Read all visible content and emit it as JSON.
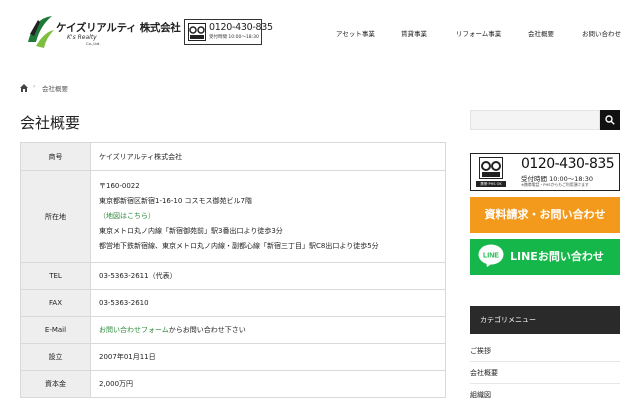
{
  "header": {
    "logo_name": "ケイズリアルティ 株式会社",
    "logo_sub": "K's Realty",
    "logo_sub2": "Co.,Ltd.",
    "tel_number": "0120-430-835",
    "tel_hours": "受付時間 10:00〜18:30",
    "nav": [
      "アセット事業",
      "賃貸事業",
      "リフォーム事業",
      "会社概要",
      "お問い合わせ"
    ]
  },
  "breadcrumb": {
    "home_icon": "home-icon",
    "current": "会社概要"
  },
  "page_title": "会社概要",
  "company_table": [
    {
      "label": "商号",
      "lines": [
        "ケイズリアルティ株式会社"
      ]
    },
    {
      "label": "所在地",
      "lines": [
        "〒160-0022",
        "東京都新宿区新宿1-16-10 コスモス御苑ビル7階",
        "（地図はこちら）",
        "東京メトロ丸ノ内線「新宿御苑前」駅3番出口より徒歩3分",
        "都営地下鉄新宿線、東京メトロ丸ノ内線・副都心線「新宿三丁目」駅C8出口より徒歩5分"
      ]
    },
    {
      "label": "TEL",
      "lines": [
        "03-5363-2611（代表）"
      ]
    },
    {
      "label": "FAX",
      "lines": [
        "03-5363-2610"
      ]
    },
    {
      "label": "E-Mail",
      "link": "お問い合わせフォーム",
      "text_after": "からお問い合わせ下さい"
    },
    {
      "label": "設立",
      "lines": [
        "2007年01月11日"
      ]
    },
    {
      "label": "資本金",
      "lines": [
        "2,000万円"
      ]
    }
  ],
  "sidebar": {
    "search_placeholder": "",
    "tel_banner": {
      "number": "0120-430-835",
      "hours": "受付時間 10:00〜18:30",
      "note": "※携帯電話・PHSからもご利用頂けます",
      "fd_caption": "携帯·PHS OK"
    },
    "contact_banner": "資料請求・お問い合わせ",
    "line_banner": "LINEお問い合わせ",
    "line_icon_text": "LINE",
    "category_title": "カテゴリメニュー",
    "category_items": [
      "ご挨拶",
      "会社概要",
      "組織図"
    ]
  },
  "colors": {
    "orange": "#f39a1c",
    "line_green": "#16b74a",
    "link_green": "#2e8b3c",
    "dark": "#2a2a2a"
  }
}
